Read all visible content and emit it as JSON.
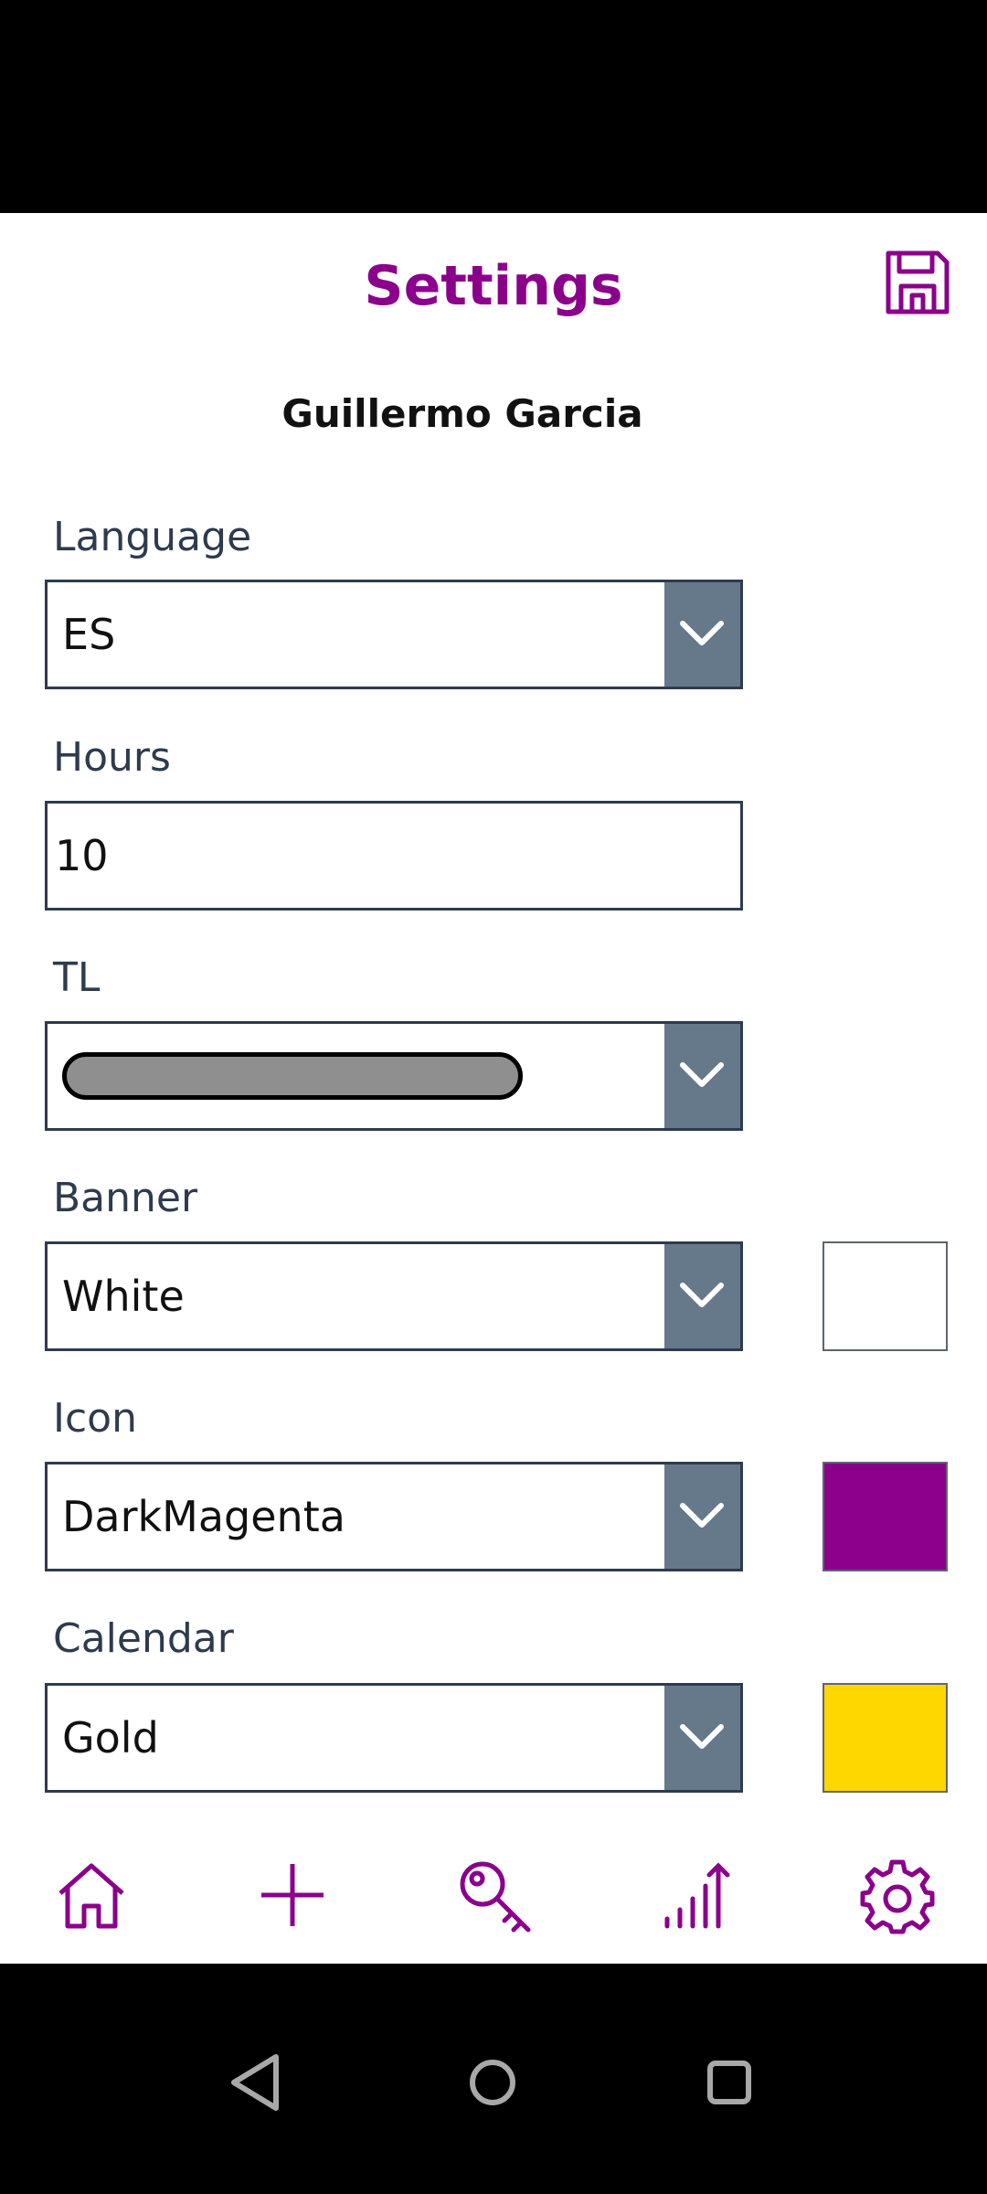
{
  "header": {
    "title": "Settings"
  },
  "user": {
    "name": "Guillermo Garcia"
  },
  "fields": {
    "language": {
      "label": "Language",
      "value": "ES"
    },
    "hours": {
      "label": "Hours",
      "value": "10"
    },
    "tl": {
      "label": "TL"
    },
    "banner": {
      "label": "Banner",
      "value": "White",
      "swatch_color": "#ffffff"
    },
    "icon": {
      "label": "Icon",
      "value": "DarkMagenta",
      "swatch_color": "#8b008b"
    },
    "calendar": {
      "label": "Calendar",
      "value": "Gold",
      "swatch_color": "#ffd700"
    }
  },
  "theme": {
    "accent": "#8b008b",
    "dropdown_button": "#66798a",
    "label_color": "#2e3b4e"
  },
  "tabs": [
    {
      "icon": "home-icon"
    },
    {
      "icon": "plus-icon"
    },
    {
      "icon": "key-icon"
    },
    {
      "icon": "chart-icon"
    },
    {
      "icon": "gear-icon"
    }
  ],
  "system_nav": [
    {
      "icon": "back-icon"
    },
    {
      "icon": "home-circle-icon"
    },
    {
      "icon": "recents-icon"
    }
  ]
}
